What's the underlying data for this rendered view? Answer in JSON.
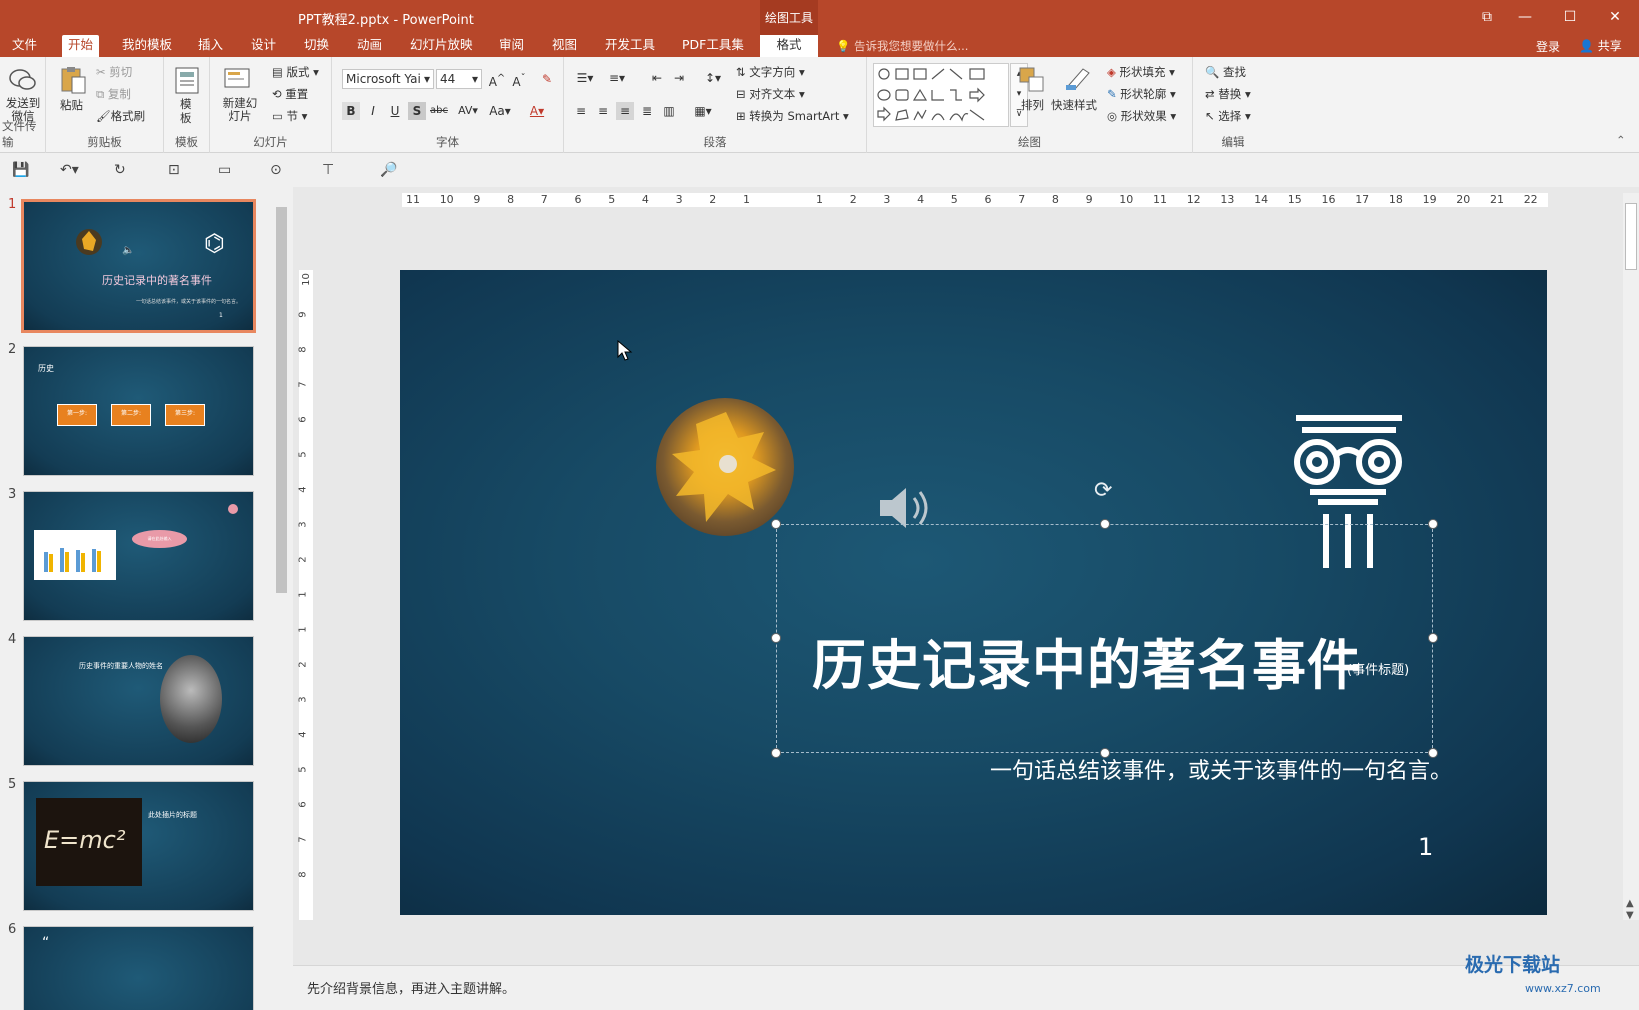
{
  "window": {
    "title": "PPT教程2.pptx - PowerPoint",
    "context_group": "绘图工具"
  },
  "tabs": [
    "文件",
    "开始",
    "我的模板",
    "插入",
    "设计",
    "切换",
    "动画",
    "幻灯片放映",
    "审阅",
    "视图",
    "开发工具",
    "PDF工具集",
    "格式"
  ],
  "active_tab": "开始",
  "tellme": "告诉我您想要做什么...",
  "account": {
    "login": "登录",
    "share": "共享"
  },
  "ribbon": {
    "groups": [
      "文件传输",
      "剪贴板",
      "模板",
      "幻灯片",
      "字体",
      "段落",
      "绘图",
      "编辑"
    ],
    "send_wechat": "发送到微信",
    "paste": "粘贴",
    "cut": "剪切",
    "copy": "复制",
    "format_painter": "格式刷",
    "template": "模板",
    "new_slide": "新建幻灯片",
    "layout": "版式",
    "reset": "重置",
    "section": "节",
    "font_name": "Microsoft Yai",
    "font_size": "44",
    "text_direction": "文字方向",
    "align_text": "对齐文本",
    "convert_smartart": "转换为 SmartArt",
    "arrange": "排列",
    "quick_styles": "快速样式",
    "shape_fill": "形状填充",
    "shape_outline": "形状轮廓",
    "shape_effects": "形状效果",
    "find": "查找",
    "replace": "替换",
    "select": "选择"
  },
  "ruler": {
    "h_left": [
      "11",
      "10",
      "9",
      "8",
      "7",
      "6",
      "5",
      "4",
      "3",
      "2",
      "1"
    ],
    "h_right": [
      "1",
      "2",
      "3",
      "4",
      "5",
      "6",
      "7",
      "8",
      "9",
      "10",
      "11",
      "12",
      "13",
      "14",
      "15",
      "16",
      "17",
      "18",
      "19",
      "20",
      "21",
      "22"
    ],
    "v_ticks": [
      "10",
      "9",
      "8",
      "7",
      "6",
      "5",
      "4",
      "3",
      "2",
      "1",
      "1",
      "2",
      "3",
      "4",
      "5",
      "6",
      "7",
      "8"
    ]
  },
  "thumbnails": [
    {
      "num": "1",
      "title": "历史记录中的著名事件",
      "sub": "一句话总结该事件，或关于该事件的一句名言。"
    },
    {
      "num": "2",
      "title": "历史",
      "steps": [
        "第一步:",
        "第二步:",
        "第三步:"
      ]
    },
    {
      "num": "3",
      "bubble": "请在此处输入"
    },
    {
      "num": "4",
      "title": "历史事件的重要人物的姓名"
    },
    {
      "num": "5",
      "title": "此处插片的标题",
      "formula": "E=mc²"
    },
    {
      "num": "6"
    }
  ],
  "slide": {
    "title": "历史记录中的著名事件",
    "title_tag": "(事件标题)",
    "subtitle": "一句话总结该事件，或关于该事件的一句名言。",
    "page_number": "1"
  },
  "notes": "先介绍背景信息，再进入主题讲解。",
  "watermark": {
    "brand": "极光下载站",
    "url": "www.xz7.com"
  }
}
